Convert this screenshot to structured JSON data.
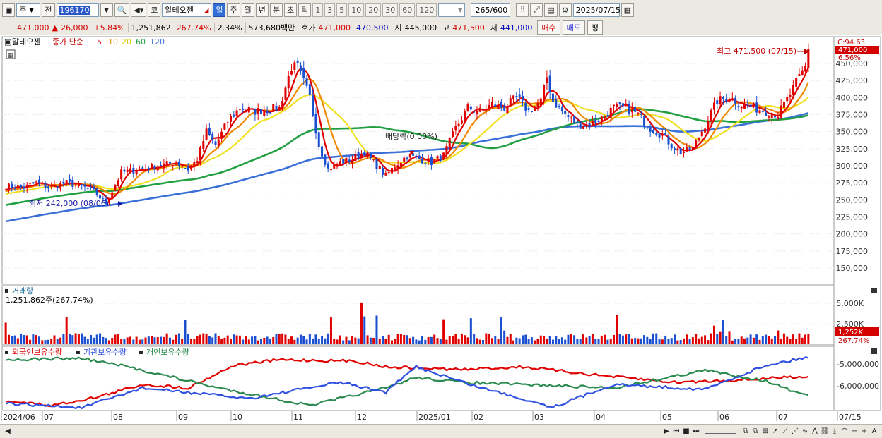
{
  "toolbar": {
    "market_type": "주",
    "prev_btn": "전",
    "stock_code": "196170",
    "market_badge": "코",
    "stock_name": "알테오젠",
    "periods": [
      "일",
      "주",
      "월",
      "년",
      "분",
      "초",
      "틱"
    ],
    "selected_period": "일",
    "intervals": [
      "1",
      "3",
      "5",
      "10",
      "20",
      "30",
      "60",
      "120"
    ],
    "count_value": "265",
    "count_total": "/600",
    "date": "2025/07/15"
  },
  "quote": {
    "price": "471,000",
    "change_arrow": "▲",
    "change": "26,000",
    "change_pct": "+5.84%",
    "volume": "1,251,862",
    "volume_ratio": "267.74%",
    "turnover": "2.34%",
    "amount": "573,680백만",
    "ask_label": "호가",
    "ask": "471,000",
    "bid": "470,500",
    "open_label": "시",
    "open": "445,000",
    "high_label": "고",
    "high": "471,500",
    "low_label": "저",
    "low": "441,000",
    "buy_button": "매수",
    "sell_button": "매도",
    "eval_button": "평"
  },
  "chart_data": [
    {
      "type": "candlestick",
      "panel": "price",
      "stock_label": "알테오젠",
      "legend": {
        "prefix": "종가 단순",
        "ma": [
          {
            "period": "5",
            "color": "#e00000"
          },
          {
            "period": "10",
            "color": "#f08a00"
          },
          {
            "period": "20",
            "color": "#f0e020"
          },
          {
            "period": "60",
            "color": "#20a040"
          },
          {
            "period": "120",
            "color": "#3a6fd8"
          }
        ]
      },
      "y_ticks": [
        "150,000",
        "175,000",
        "200,000",
        "225,000",
        "250,000",
        "275,000",
        "300,000",
        "325,000",
        "350,000",
        "375,000",
        "400,000",
        "425,000",
        "450,000"
      ],
      "ylim": [
        130000,
        480000
      ],
      "x_labels": [
        "2024/06",
        "07",
        "08",
        "09",
        "10",
        "11",
        "12",
        "2025/01",
        "02",
        "03",
        "04",
        "05",
        "06",
        "07",
        "07/15"
      ],
      "annotations": {
        "high": "최고 471,500 (07/15)",
        "low": "최저 242,000 (08/06)",
        "dividend": "배당락(0.00%)",
        "current_price": "471,000",
        "current_pct": "6.56%",
        "c_value": "C:94.63"
      },
      "close_anchors": [
        [
          0,
          270000
        ],
        [
          6,
          268000
        ],
        [
          10,
          275000
        ],
        [
          14,
          268000
        ],
        [
          20,
          275000
        ],
        [
          26,
          268000
        ],
        [
          29,
          262000
        ],
        [
          33,
          245000
        ],
        [
          38,
          290000
        ],
        [
          44,
          295000
        ],
        [
          50,
          300000
        ],
        [
          56,
          305000
        ],
        [
          60,
          295000
        ],
        [
          63,
          310000
        ],
        [
          66,
          350000
        ],
        [
          69,
          330000
        ],
        [
          73,
          365000
        ],
        [
          77,
          385000
        ],
        [
          82,
          380000
        ],
        [
          86,
          382000
        ],
        [
          90,
          385000
        ],
        [
          94,
          445000
        ],
        [
          96,
          445000
        ],
        [
          100,
          400000
        ],
        [
          103,
          330000
        ],
        [
          106,
          295000
        ],
        [
          110,
          305000
        ],
        [
          114,
          310000
        ],
        [
          118,
          320000
        ],
        [
          122,
          300000
        ],
        [
          125,
          285000
        ],
        [
          128,
          300000
        ],
        [
          132,
          315000
        ],
        [
          136,
          310000
        ],
        [
          140,
          305000
        ],
        [
          144,
          315000
        ],
        [
          148,
          355000
        ],
        [
          152,
          385000
        ],
        [
          156,
          380000
        ],
        [
          160,
          390000
        ],
        [
          164,
          385000
        ],
        [
          168,
          400000
        ],
        [
          172,
          380000
        ],
        [
          176,
          395000
        ],
        [
          178,
          430000
        ],
        [
          180,
          395000
        ],
        [
          182,
          385000
        ],
        [
          184,
          375000
        ],
        [
          188,
          360000
        ],
        [
          192,
          360000
        ],
        [
          196,
          370000
        ],
        [
          200,
          385000
        ],
        [
          204,
          385000
        ],
        [
          208,
          375000
        ],
        [
          212,
          355000
        ],
        [
          216,
          345000
        ],
        [
          219,
          330000
        ],
        [
          222,
          320000
        ],
        [
          226,
          325000
        ],
        [
          230,
          360000
        ],
        [
          234,
          395000
        ],
        [
          238,
          400000
        ],
        [
          242,
          390000
        ],
        [
          246,
          385000
        ],
        [
          250,
          380000
        ],
        [
          254,
          375000
        ],
        [
          258,
          405000
        ],
        [
          261,
          430000
        ],
        [
          263,
          445000
        ],
        [
          264,
          471000
        ]
      ]
    },
    {
      "type": "bar",
      "panel": "volume",
      "label": "거래량",
      "value_text": "1,251,862주(267.74%)",
      "y_ticks": [
        "5,000K",
        "2,500K"
      ],
      "last_value": "1,252K",
      "last_pct": "267.74%",
      "ylim": [
        0,
        6000000
      ]
    },
    {
      "type": "line",
      "panel": "holdings",
      "series_labels": [
        "외국인보유수량",
        "기관보유수량",
        "개인보유수량"
      ],
      "series_colors": [
        "#e00000",
        "#2a8a50",
        "#3050e0"
      ],
      "y_ticks": [
        "-5,000,000",
        "-6,000,000"
      ]
    }
  ],
  "statusbar": {
    "left_icon": "scroll-left-icon"
  }
}
